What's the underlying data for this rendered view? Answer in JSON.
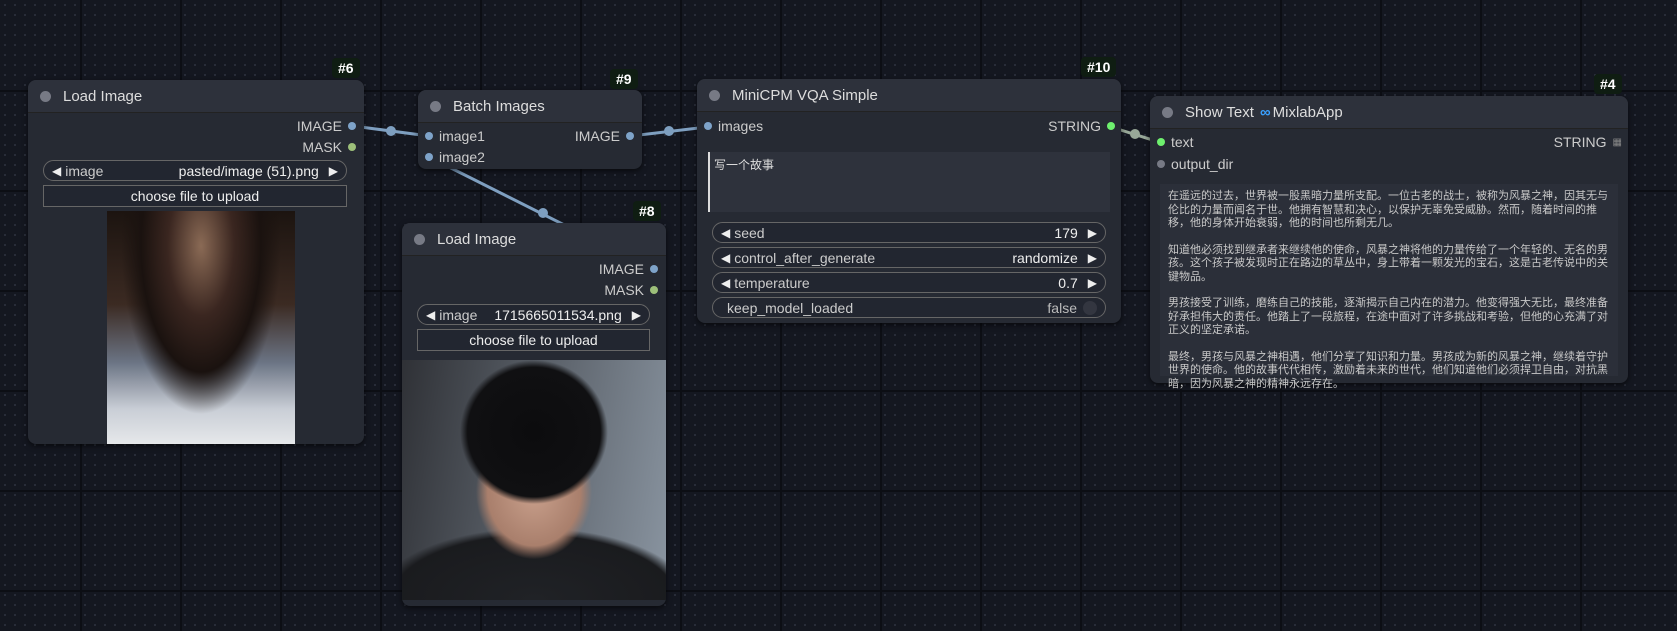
{
  "nodes": {
    "load6": {
      "id": "#6",
      "title": "Load Image",
      "outputs": [
        "IMAGE",
        "MASK"
      ],
      "image_label": "image",
      "image_value": "pasted/image (51).png",
      "upload_label": "choose file to upload"
    },
    "batch9": {
      "id": "#9",
      "title": "Batch Images",
      "inputs": [
        "image1",
        "image2"
      ],
      "outputs": [
        "IMAGE"
      ]
    },
    "load8": {
      "id": "#8",
      "title": "Load Image",
      "outputs": [
        "IMAGE",
        "MASK"
      ],
      "image_label": "image",
      "image_value": "1715665011534.png",
      "upload_label": "choose file to upload"
    },
    "minicpm10": {
      "id": "#10",
      "title": "MiniCPM VQA Simple",
      "inputs": [
        "images"
      ],
      "outputs": [
        "STRING"
      ],
      "prompt": "写一个故事",
      "widgets": [
        {
          "label": "seed",
          "value": "179"
        },
        {
          "label": "control_after_generate",
          "value": "randomize"
        },
        {
          "label": "temperature",
          "value": "0.7"
        },
        {
          "label": "keep_model_loaded",
          "value": "false"
        }
      ]
    },
    "show4": {
      "id": "#4",
      "title": "Show Text",
      "brand": "MixlabApp",
      "inputs": [
        "text",
        "output_dir"
      ],
      "outputs": [
        "STRING"
      ],
      "text": [
        "在遥远的过去，世界被一股黑暗力量所支配。一位古老的战士，被称为风暴之神，因其无与伦比的力量而闻名于世。他拥有智慧和决心，以保护无辜免受威胁。然而，随着时间的推移，他的身体开始衰弱，他的时间也所剩无几。",
        "知道他必须找到继承者来继续他的使命，风暴之神将他的力量传给了一个年轻的、无名的男孩。这个孩子被发现时正在路边的草丛中，身上带着一颗发光的宝石，这是古老传说中的关键物品。",
        "男孩接受了训练，磨练自己的技能，逐渐揭示自己内在的潜力。他变得强大无比，最终准备好承担伟大的责任。他踏上了一段旅程，在途中面对了许多挑战和考验，但他的心充满了对正义的坚定承诺。",
        "最终，男孩与风暴之神相遇，他们分享了知识和力量。男孩成为新的风暴之神，继续着守护世界的使命。他的故事代代相传，激励着未来的世代，他们知道他们必须捍卫自由，对抗黑暗，因为风暴之神的精神永远存在。"
      ]
    }
  },
  "colors": {
    "image_slot": "#7ea3c9",
    "mask_slot": "#9dc07a",
    "string_slot": "#6ef06e",
    "link_image": "#7e9fc0",
    "link_string": "#98a898",
    "badge_bg": "#0f1d12"
  }
}
